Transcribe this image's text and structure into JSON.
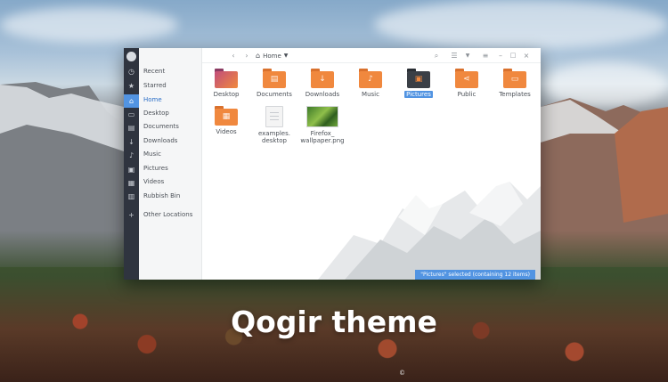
{
  "hero": {
    "title": "Qogir theme",
    "copyright": "©"
  },
  "window": {
    "location": "Home",
    "sidebar": [
      {
        "label": "Recent",
        "icon": "clock-icon"
      },
      {
        "label": "Starred",
        "icon": "star-icon"
      },
      {
        "label": "Home",
        "icon": "home-icon",
        "active": true
      },
      {
        "label": "Desktop",
        "icon": "desktop-icon"
      },
      {
        "label": "Documents",
        "icon": "document-icon"
      },
      {
        "label": "Downloads",
        "icon": "download-icon"
      },
      {
        "label": "Music",
        "icon": "music-icon"
      },
      {
        "label": "Pictures",
        "icon": "image-icon"
      },
      {
        "label": "Videos",
        "icon": "video-icon"
      },
      {
        "label": "Rubbish Bin",
        "icon": "trash-icon"
      },
      {
        "label": "Other Locations",
        "icon": "plus-icon"
      }
    ],
    "files": [
      {
        "name": "Desktop",
        "kind": "folder",
        "color": "#a13f6e"
      },
      {
        "name": "Documents",
        "kind": "folder",
        "color": "#f0883e"
      },
      {
        "name": "Downloads",
        "kind": "folder",
        "color": "#f0883e"
      },
      {
        "name": "Music",
        "kind": "folder",
        "color": "#f0883e"
      },
      {
        "name": "Pictures",
        "kind": "folder",
        "color": "#3a3f46",
        "selected": true
      },
      {
        "name": "Public",
        "kind": "folder",
        "color": "#f0883e"
      },
      {
        "name": "Templates",
        "kind": "folder",
        "color": "#f0883e"
      },
      {
        "name": "Videos",
        "kind": "folder",
        "color": "#f0883e"
      },
      {
        "name": "examples.\ndesktop",
        "kind": "document"
      },
      {
        "name": "Firefox_\nwallpaper.png",
        "kind": "image"
      }
    ],
    "status": "\"Pictures\" selected  (containing 12 items)"
  },
  "colors": {
    "accent": "#5294e2",
    "rail": "#2f343f",
    "folder": "#f0883e"
  }
}
